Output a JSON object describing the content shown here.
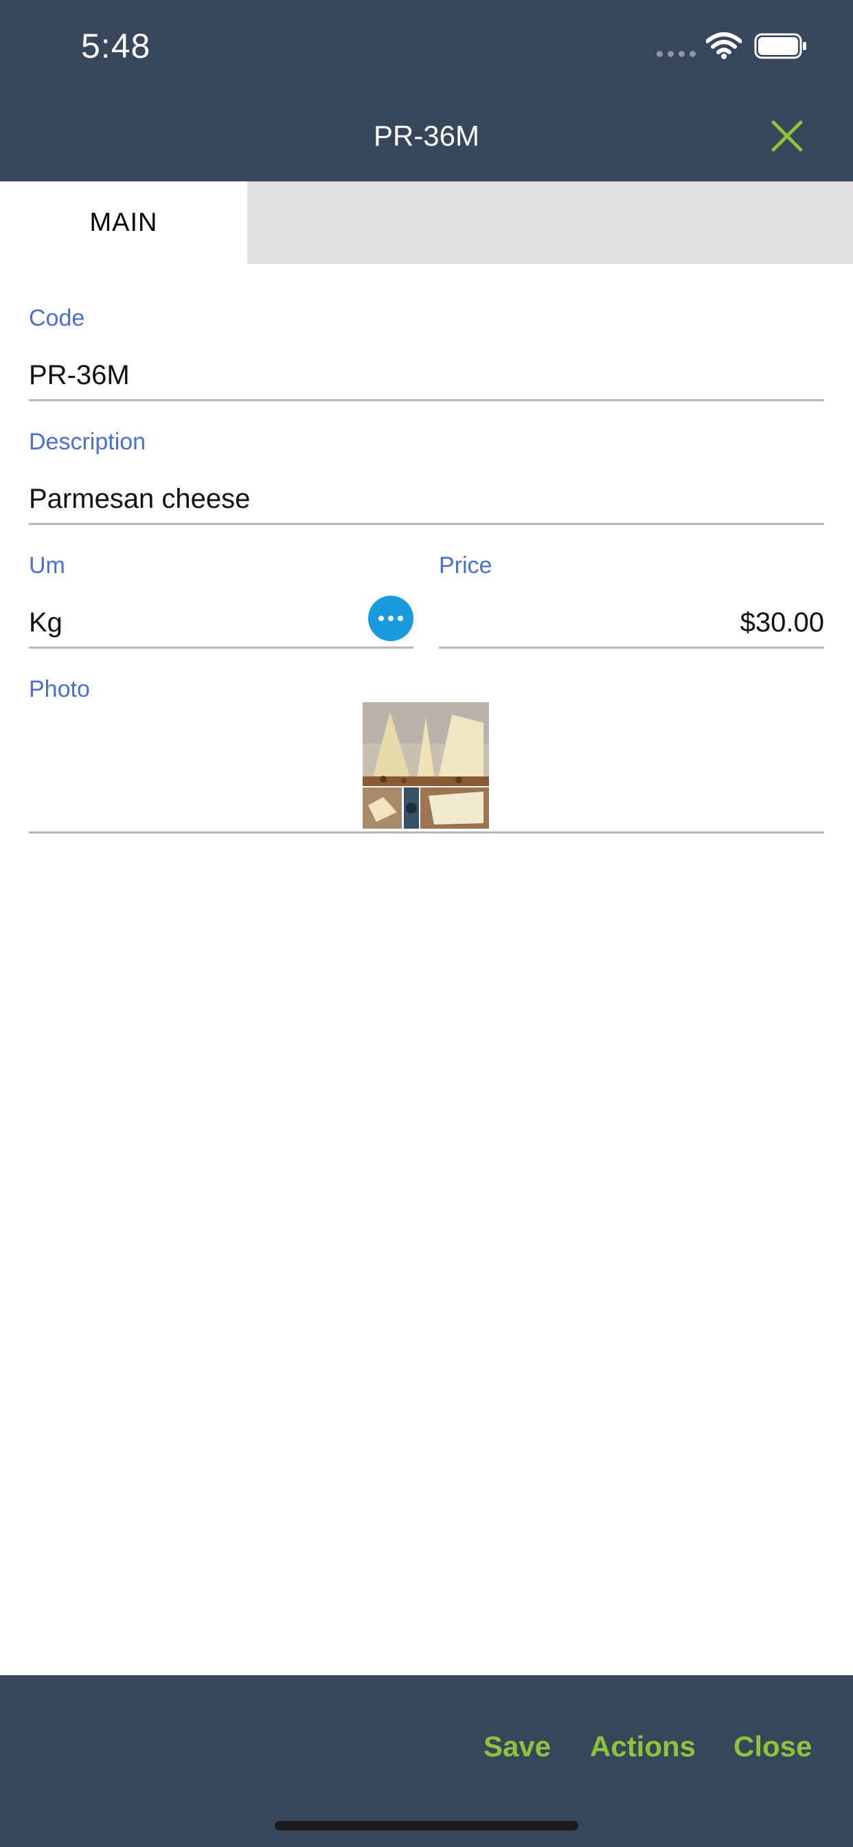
{
  "status_bar": {
    "time": "5:48"
  },
  "header": {
    "title": "PR-36M"
  },
  "tabs": [
    {
      "label": "MAIN"
    }
  ],
  "form": {
    "code": {
      "label": "Code",
      "value": "PR-36M"
    },
    "description": {
      "label": "Description",
      "value": "Parmesan cheese"
    },
    "um": {
      "label": "Um",
      "value": "Kg"
    },
    "price": {
      "label": "Price",
      "value": "$30.00"
    },
    "photo": {
      "label": "Photo"
    }
  },
  "footer": {
    "save_label": "Save",
    "actions_label": "Actions",
    "close_label": "Close"
  },
  "colors": {
    "header_bg": "#374759",
    "accent_green": "#8cc43c",
    "label_blue": "#4a6fd4",
    "button_blue": "#1a9be0"
  }
}
